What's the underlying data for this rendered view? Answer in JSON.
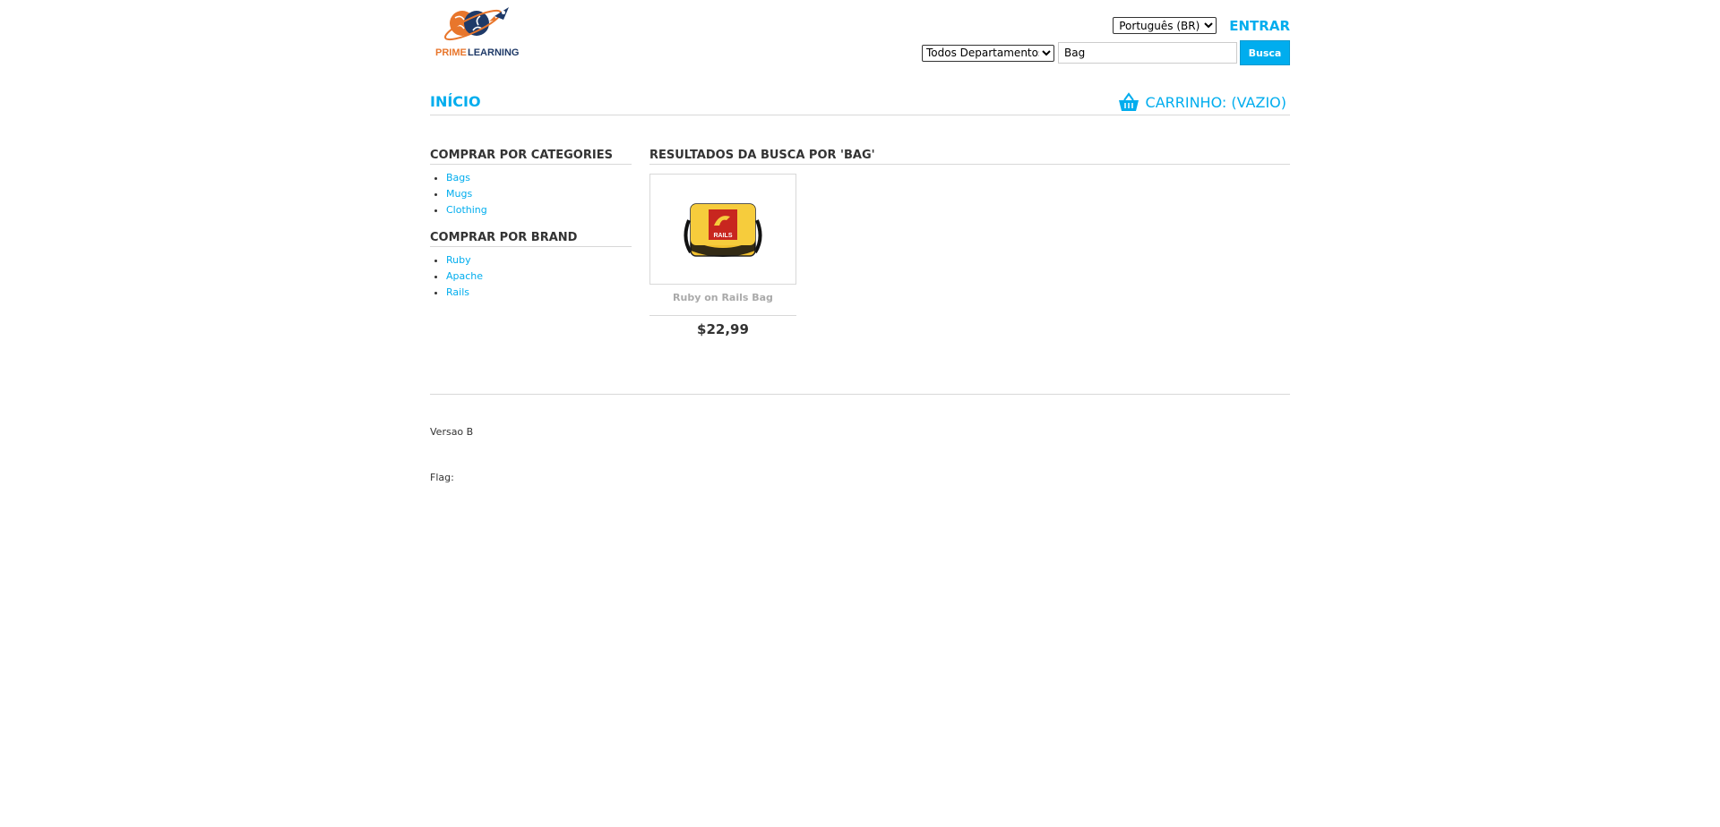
{
  "header": {
    "logo_text_prime": "PRIME",
    "logo_text_learning": "LEARNING",
    "language_selected": "Português (BR)",
    "login_label": "ENTRAR",
    "department_selected": "Todos Departamentos",
    "search_value": "Bag",
    "search_button_label": "Busca"
  },
  "nav": {
    "home_label": "INÍCIO",
    "cart_label": "CARRINHO: (VAZIO)"
  },
  "sidebar": {
    "categories_heading": "COMPRAR POR CATEGORIES",
    "categories": [
      {
        "label": "Bags"
      },
      {
        "label": "Mugs"
      },
      {
        "label": "Clothing"
      }
    ],
    "brand_heading": "COMPRAR POR BRAND",
    "brands": [
      {
        "label": "Ruby"
      },
      {
        "label": "Apache"
      },
      {
        "label": "Rails"
      }
    ]
  },
  "results": {
    "heading": "RESULTADOS DA BUSCA POR 'BAG'",
    "products": [
      {
        "name": "Ruby on Rails Bag",
        "price": "$22,99",
        "image_label": "RAILS"
      }
    ]
  },
  "footer": {
    "version_text": "Versao B",
    "flag_text": "Flag:"
  },
  "colors": {
    "accent": "#00adee",
    "logo_orange": "#e8762c",
    "logo_navy": "#1f3a68"
  }
}
